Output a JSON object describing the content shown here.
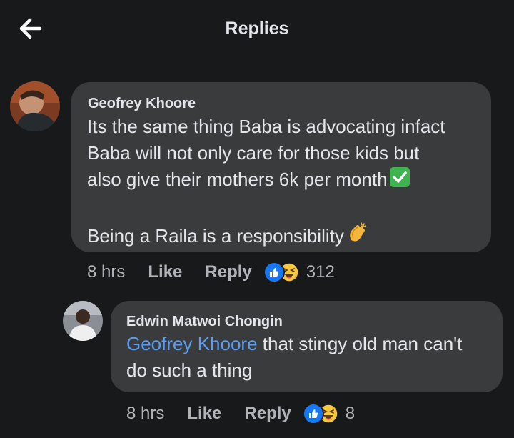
{
  "header": {
    "title": "Replies"
  },
  "comment": {
    "author": "Geofrey Khoore",
    "lines": [
      "Its the same thing Baba is advocating infact",
      "Baba will not only care for those kids but",
      "also give their mothers 6k per month",
      "Being a Raila is a responsibility"
    ],
    "time": "8 hrs",
    "like_label": "Like",
    "reply_label": "Reply",
    "reaction_count": "312"
  },
  "reply": {
    "author": "Edwin Matwoi Chongin",
    "mention": "Geofrey Khoore",
    "text_line1": " that stingy old man can't",
    "text_line2": "do such a thing",
    "time": "8 hrs",
    "like_label": "Like",
    "reply_label": "Reply",
    "reaction_count": "8"
  },
  "colors": {
    "background": "#18191a",
    "bubble": "#3a3b3c",
    "text": "#e4e6eb",
    "muted": "#b0b3b8",
    "mention": "#5b9df5",
    "like_blue": "#1877f2"
  },
  "icons": [
    "back-arrow-icon",
    "check-mark-emoji",
    "clapping-hands-emoji",
    "like-reaction-icon",
    "haha-reaction-icon"
  ]
}
